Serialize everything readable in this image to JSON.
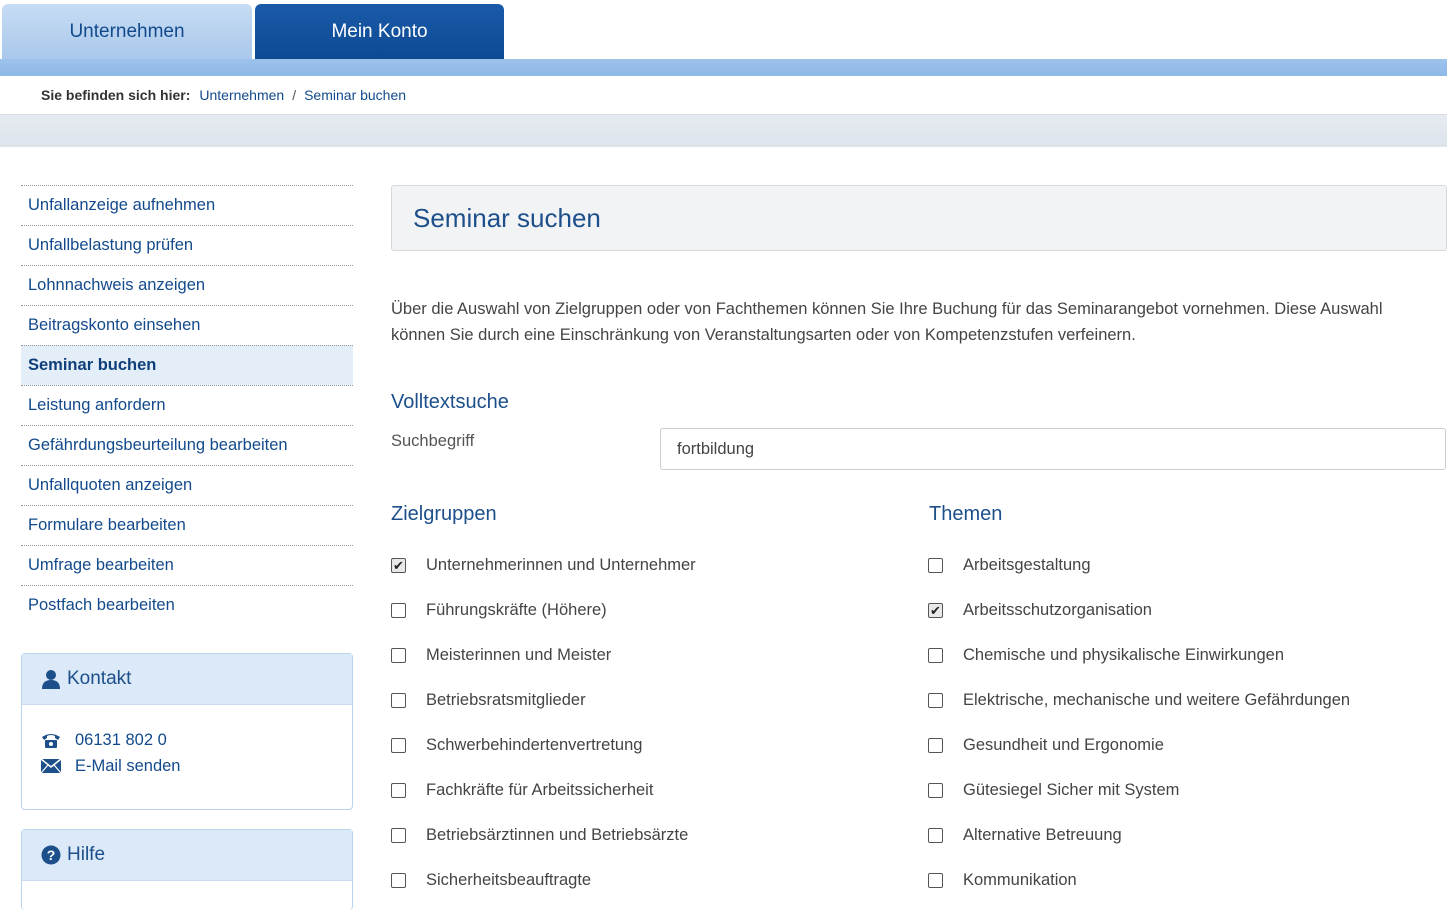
{
  "tabs": [
    {
      "label": "Unternehmen"
    },
    {
      "label": "Mein Konto"
    }
  ],
  "breadcrumb": {
    "label": "Sie befinden sich hier:",
    "items": [
      "Unternehmen",
      "Seminar buchen"
    ],
    "separator": "/"
  },
  "nav": {
    "items": [
      {
        "label": "Unfallanzeige aufnehmen"
      },
      {
        "label": "Unfallbelastung prüfen"
      },
      {
        "label": "Lohnnachweis anzeigen"
      },
      {
        "label": "Beitragskonto einsehen"
      },
      {
        "label": "Seminar buchen",
        "active": true
      },
      {
        "label": "Leistung anfordern"
      },
      {
        "label": "Gefährdungsbeurteilung bearbeiten"
      },
      {
        "label": "Unfallquoten anzeigen"
      },
      {
        "label": "Formulare bearbeiten"
      },
      {
        "label": "Umfrage bearbeiten"
      },
      {
        "label": "Postfach bearbeiten"
      }
    ]
  },
  "kontakt": {
    "title": "Kontakt",
    "phone": "06131 802 0",
    "email": "E-Mail senden",
    "icons": [
      "user-icon",
      "phone-icon",
      "envelope-icon"
    ]
  },
  "hilfe": {
    "title": "Hilfe",
    "icon": "question-circle-icon"
  },
  "main": {
    "title": "Seminar suchen",
    "intro": "Über die Auswahl von Zielgruppen oder von Fachthemen können Sie Ihre Buchung für das Seminarangebot vornehmen. Diese Auswahl können Sie durch eine Einschränkung von Veranstaltungsarten oder von Kompetenzstufen verfeinern.",
    "volltext": {
      "title": "Volltextsuche",
      "label": "Suchbegriff",
      "value": "fortbildung"
    },
    "zielgruppen": {
      "title": "Zielgruppen",
      "items": [
        {
          "label": "Unternehmerinnen und Unternehmer",
          "checked": true
        },
        {
          "label": "Führungskräfte (Höhere)",
          "checked": false
        },
        {
          "label": "Meisterinnen und Meister",
          "checked": false
        },
        {
          "label": "Betriebsratsmitglieder",
          "checked": false
        },
        {
          "label": "Schwerbehindertenvertretung",
          "checked": false
        },
        {
          "label": "Fachkräfte für Arbeitssicherheit",
          "checked": false
        },
        {
          "label": "Betriebsärztinnen und Betriebsärzte",
          "checked": false
        },
        {
          "label": "Sicherheitsbeauftragte",
          "checked": false
        }
      ]
    },
    "themen": {
      "title": "Themen",
      "items": [
        {
          "label": "Arbeitsgestaltung",
          "checked": false
        },
        {
          "label": "Arbeitsschutzorganisation",
          "checked": true
        },
        {
          "label": "Chemische und physikalische Einwirkungen",
          "checked": false
        },
        {
          "label": "Elektrische, mechanische und weitere Gefährdungen",
          "checked": false
        },
        {
          "label": "Gesundheit und Ergonomie",
          "checked": false
        },
        {
          "label": "Gütesiegel Sicher mit System",
          "checked": false
        },
        {
          "label": "Alternative Betreuung",
          "checked": false
        },
        {
          "label": "Kommunikation",
          "checked": false
        }
      ]
    }
  },
  "colors": {
    "brand_dark": "#0d4a94",
    "brand_light": "#a9c8ec",
    "link": "#134a8c",
    "heading": "#1d4f8a"
  }
}
